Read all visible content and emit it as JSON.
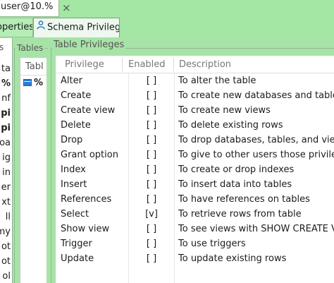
{
  "editor_tab": {
    "title": "user@10.%"
  },
  "tabs": [
    {
      "label": "operties"
    },
    {
      "label": "Schema Privileges"
    }
  ],
  "left_strip": {
    "logs_label": "ogs",
    "items": [
      "ta",
      "%",
      "nf",
      "pi",
      "pi",
      "oa",
      "ig",
      "in",
      "er",
      "xt",
      "ll",
      "my",
      "ot",
      "ot",
      "ol"
    ]
  },
  "tables_panel": {
    "caption": "Tables",
    "header": "Tabl",
    "row": "%"
  },
  "privileges": {
    "caption": "Table Privileges",
    "columns": [
      "Privilege",
      "Enabled",
      "Description"
    ],
    "rows": [
      {
        "privilege": "Alter",
        "enabled": "[ ]",
        "description": "To alter the table"
      },
      {
        "privilege": "Create",
        "enabled": "[ ]",
        "description": "To create new databases and tables"
      },
      {
        "privilege": "Create view",
        "enabled": "[ ]",
        "description": "To create new views"
      },
      {
        "privilege": "Delete",
        "enabled": "[ ]",
        "description": "To delete existing rows"
      },
      {
        "privilege": "Drop",
        "enabled": "[ ]",
        "description": "To drop databases, tables, and views"
      },
      {
        "privilege": "Grant option",
        "enabled": "[ ]",
        "description": "To give to other users those privileges yo"
      },
      {
        "privilege": "Index",
        "enabled": "[ ]",
        "description": "To create or drop indexes"
      },
      {
        "privilege": "Insert",
        "enabled": "[ ]",
        "description": "To insert data into tables"
      },
      {
        "privilege": "References",
        "enabled": "[ ]",
        "description": "To have references on tables"
      },
      {
        "privilege": "Select",
        "enabled": "[v]",
        "description": "To retrieve rows from table"
      },
      {
        "privilege": "Show view",
        "enabled": "[ ]",
        "description": "To see views with SHOW CREATE VIEW"
      },
      {
        "privilege": "Trigger",
        "enabled": "[ ]",
        "description": "To use triggers"
      },
      {
        "privilege": "Update",
        "enabled": "[ ]",
        "description": "To update existing rows"
      }
    ]
  },
  "icons": {
    "close": "close-icon",
    "user": "user-icon",
    "table": "table-icon"
  }
}
